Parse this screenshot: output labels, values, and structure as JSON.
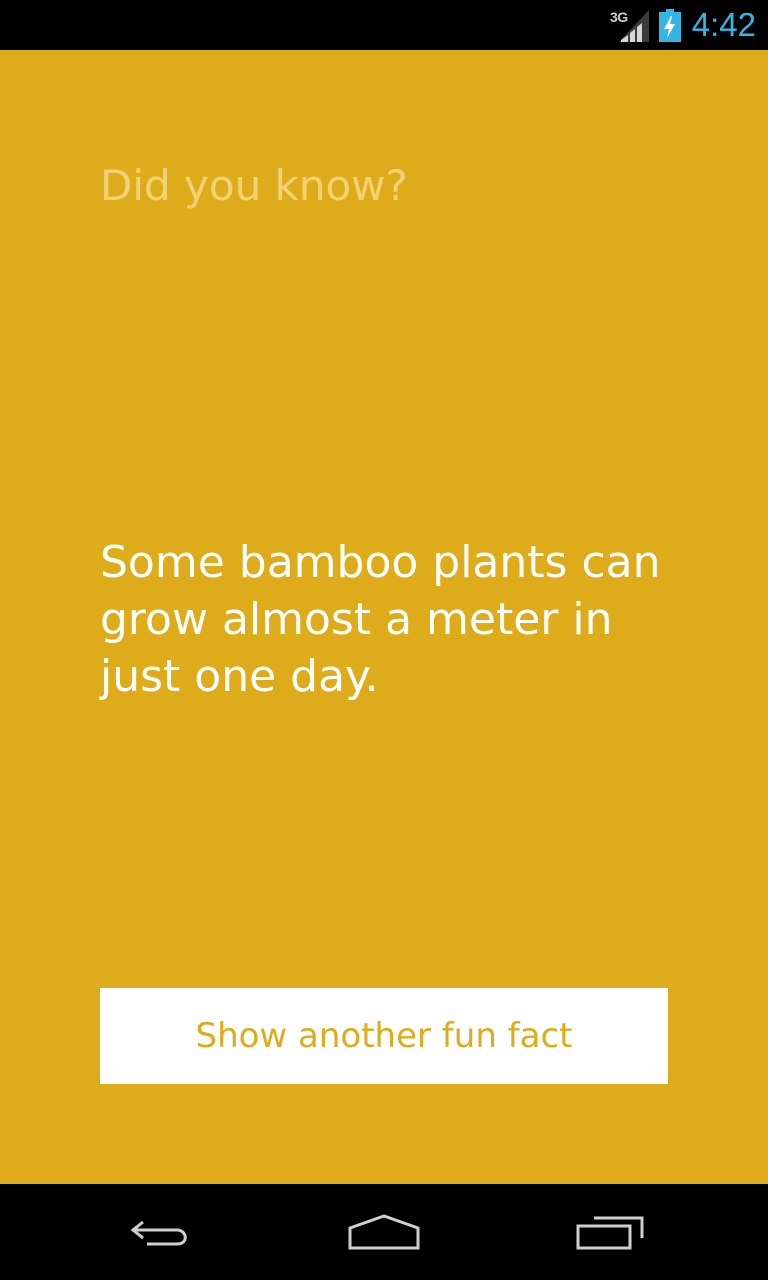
{
  "status_bar": {
    "network": "3G",
    "time": "4:42",
    "icons": [
      "signal-icon",
      "battery-charging-icon"
    ],
    "accent_color": "#33b5e5"
  },
  "app": {
    "background_color": "#deac1a",
    "header": "Did you know?",
    "fact": "Some bamboo plants can grow almost a meter in just one day.",
    "button_label": "Show another fun fact",
    "button_text_color": "#deac1a"
  },
  "nav_bar": {
    "icons": [
      "back-icon",
      "home-icon",
      "recent-apps-icon"
    ]
  }
}
